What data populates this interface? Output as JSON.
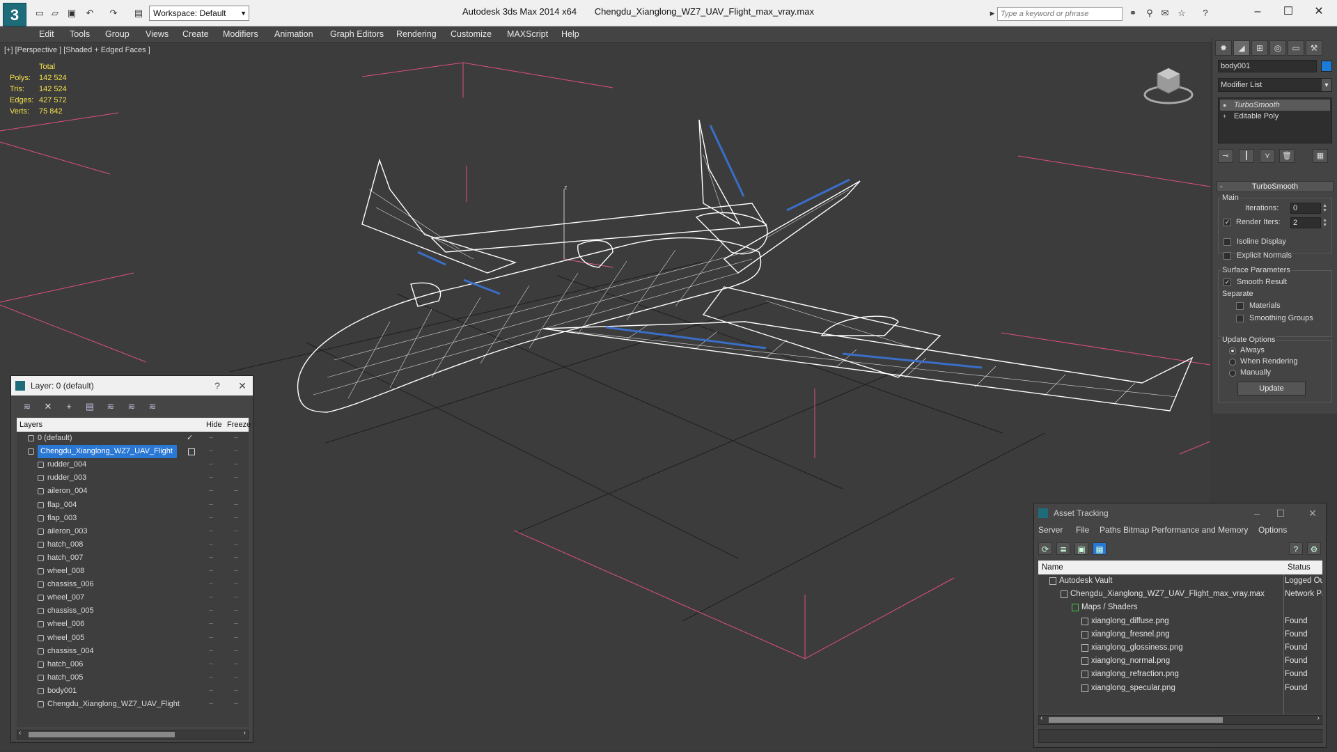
{
  "titlebar": {
    "app_name": "Autodesk 3ds Max  2014 x64",
    "file_name": "Chengdu_Xianglong_WZ7_UAV_Flight_max_vray.max",
    "workspace": "Workspace: Default",
    "search_placeholder": "Type a keyword or phrase",
    "logo": "3",
    "minimize": "–",
    "maximize": "☐",
    "close": "✕"
  },
  "menu": [
    "Edit",
    "Tools",
    "Group",
    "Views",
    "Create",
    "Modifiers",
    "Animation",
    "Graph Editors",
    "Rendering",
    "Customize",
    "MAXScript",
    "Help"
  ],
  "viewport": {
    "label": "[+] [Perspective ] [Shaded + Edged Faces ]",
    "stats_header": "Total",
    "stats": [
      {
        "key": "Polys:",
        "value": "142 524"
      },
      {
        "key": "Tris:",
        "value": "142 524"
      },
      {
        "key": "Edges:",
        "value": "427 572"
      },
      {
        "key": "Verts:",
        "value": "75 842"
      }
    ],
    "axis_z": "z",
    "colors": {
      "grid": "#1e1e1e",
      "gizmo": "#e0507a",
      "wire": "#ffffff",
      "control_surface": "#3a6ec8",
      "background": "#3c3c3c"
    }
  },
  "command_panel": {
    "object_name": "body001",
    "object_color": "#1c7bd8",
    "modifier_list": "Modifier List",
    "stack": [
      {
        "label": "TurboSmooth",
        "selected": true
      },
      {
        "label": "Editable Poly",
        "selected": false
      }
    ],
    "rollout_title": "TurboSmooth",
    "main_group": "Main",
    "iterations_label": "Iterations:",
    "iterations_value": "0",
    "render_iters_label": "Render Iters:",
    "render_iters_value": "2",
    "isoline_label": "Isoline Display",
    "explicit_normals_label": "Explicit Normals",
    "surface_group": "Surface Parameters",
    "smooth_result_label": "Smooth Result",
    "separate_label": "Separate",
    "materials_label": "Materials",
    "smoothing_groups_label": "Smoothing Groups",
    "update_group": "Update Options",
    "always_label": "Always",
    "when_rendering_label": "When Rendering",
    "manually_label": "Manually",
    "update_button": "Update"
  },
  "layer_dialog": {
    "title": "Layer: 0 (default)",
    "help": "?",
    "close": "✕",
    "col_layers": "Layers",
    "col_hide": "Hide",
    "col_freeze": "Freeze",
    "rows": [
      {
        "name": "0 (default)",
        "level": 0,
        "selected": false,
        "check": "✓"
      },
      {
        "name": "Chengdu_Xianglong_WZ7_UAV_Flight",
        "level": 0,
        "selected": true,
        "check": ""
      },
      {
        "name": "rudder_004",
        "level": 1,
        "selected": false,
        "check": ""
      },
      {
        "name": "rudder_003",
        "level": 1,
        "selected": false,
        "check": ""
      },
      {
        "name": "aileron_004",
        "level": 1,
        "selected": false,
        "check": ""
      },
      {
        "name": "flap_004",
        "level": 1,
        "selected": false,
        "check": ""
      },
      {
        "name": "flap_003",
        "level": 1,
        "selected": false,
        "check": ""
      },
      {
        "name": "aileron_003",
        "level": 1,
        "selected": false,
        "check": ""
      },
      {
        "name": "hatch_008",
        "level": 1,
        "selected": false,
        "check": ""
      },
      {
        "name": "hatch_007",
        "level": 1,
        "selected": false,
        "check": ""
      },
      {
        "name": "wheel_008",
        "level": 1,
        "selected": false,
        "check": ""
      },
      {
        "name": "chassiss_006",
        "level": 1,
        "selected": false,
        "check": ""
      },
      {
        "name": "wheel_007",
        "level": 1,
        "selected": false,
        "check": ""
      },
      {
        "name": "chassiss_005",
        "level": 1,
        "selected": false,
        "check": ""
      },
      {
        "name": "wheel_006",
        "level": 1,
        "selected": false,
        "check": ""
      },
      {
        "name": "wheel_005",
        "level": 1,
        "selected": false,
        "check": ""
      },
      {
        "name": "chassiss_004",
        "level": 1,
        "selected": false,
        "check": ""
      },
      {
        "name": "hatch_006",
        "level": 1,
        "selected": false,
        "check": ""
      },
      {
        "name": "hatch_005",
        "level": 1,
        "selected": false,
        "check": ""
      },
      {
        "name": "body001",
        "level": 1,
        "selected": false,
        "check": ""
      },
      {
        "name": "Chengdu_Xianglong_WZ7_UAV_Flight",
        "level": 1,
        "selected": false,
        "check": ""
      }
    ]
  },
  "asset_dialog": {
    "title": "Asset Tracking",
    "menu": [
      "Server",
      "File",
      "Paths",
      "Bitmap Performance and Memory",
      "Options"
    ],
    "col_name": "Name",
    "col_status": "Status",
    "rows": [
      {
        "name": "Autodesk Vault",
        "status": "Logged Out",
        "level": 0
      },
      {
        "name": "Chengdu_Xianglong_WZ7_UAV_Flight_max_vray.max",
        "status": "Network Path",
        "level": 1
      },
      {
        "name": "Maps / Shaders",
        "status": "",
        "level": 2
      },
      {
        "name": "xianglong_diffuse.png",
        "status": "Found",
        "level": 3
      },
      {
        "name": "xianglong_fresnel.png",
        "status": "Found",
        "level": 3
      },
      {
        "name": "xianglong_glossiness.png",
        "status": "Found",
        "level": 3
      },
      {
        "name": "xianglong_normal.png",
        "status": "Found",
        "level": 3
      },
      {
        "name": "xianglong_refraction.png",
        "status": "Found",
        "level": 3
      },
      {
        "name": "xianglong_specular.png",
        "status": "Found",
        "level": 3
      }
    ]
  }
}
